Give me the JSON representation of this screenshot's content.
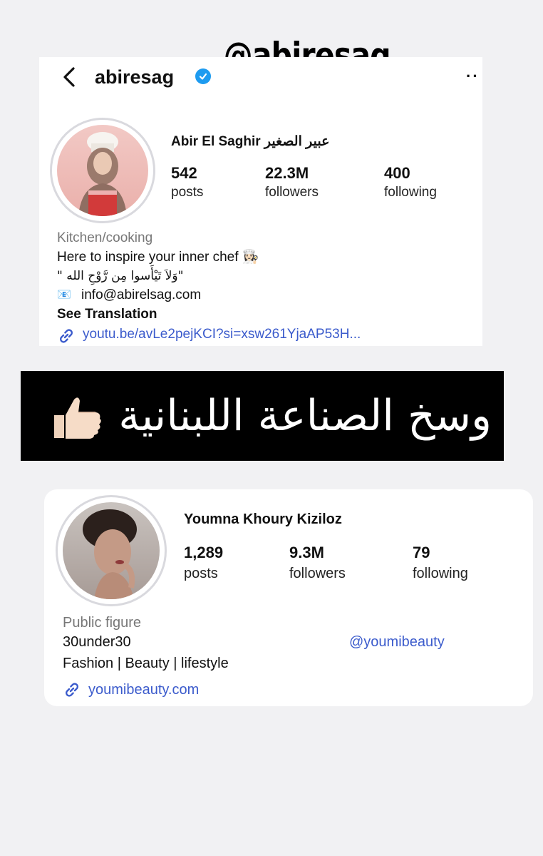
{
  "sticker": {
    "text": "@abiresag"
  },
  "profile1": {
    "username": "abiresag",
    "full_name": "Abir El Saghir عبير الصغير",
    "stats": [
      {
        "value": "542",
        "label": "posts"
      },
      {
        "value": "22.3M",
        "label": "followers"
      },
      {
        "value": "400",
        "label": "following"
      }
    ],
    "category": "Kitchen/cooking",
    "bio_line1": "Here to inspire your inner chef 👩🏻‍🍳",
    "bio_line2": "\"وَلاَ تَيْأَسوا مِن رَّوْحِ الله \"",
    "email_icon": "📧",
    "email": "info@abirelsag.com",
    "see_translation": "See Translation",
    "link": "youtu.be/avLe2pejKCI?si=xsw261YjaAP53H..."
  },
  "banner": {
    "text": "وسخ الصناعة اللبنانية",
    "emoji": "thumbs-up"
  },
  "profile2": {
    "full_name": "Youmna Khoury Kiziloz",
    "stats": [
      {
        "value": "1,289",
        "label": "posts"
      },
      {
        "value": "9.3M",
        "label": "followers"
      },
      {
        "value": "79",
        "label": "following"
      }
    ],
    "category": "Public figure",
    "bio_line1": "30under30",
    "bio_line2": "Fashion | Beauty | lifestyle",
    "mention": "@youmibeauty",
    "link": "youmibeauty.com"
  },
  "colors": {
    "link": "#3b5bcc",
    "verified": "#1d9bf0",
    "banner_bg": "#000000"
  }
}
